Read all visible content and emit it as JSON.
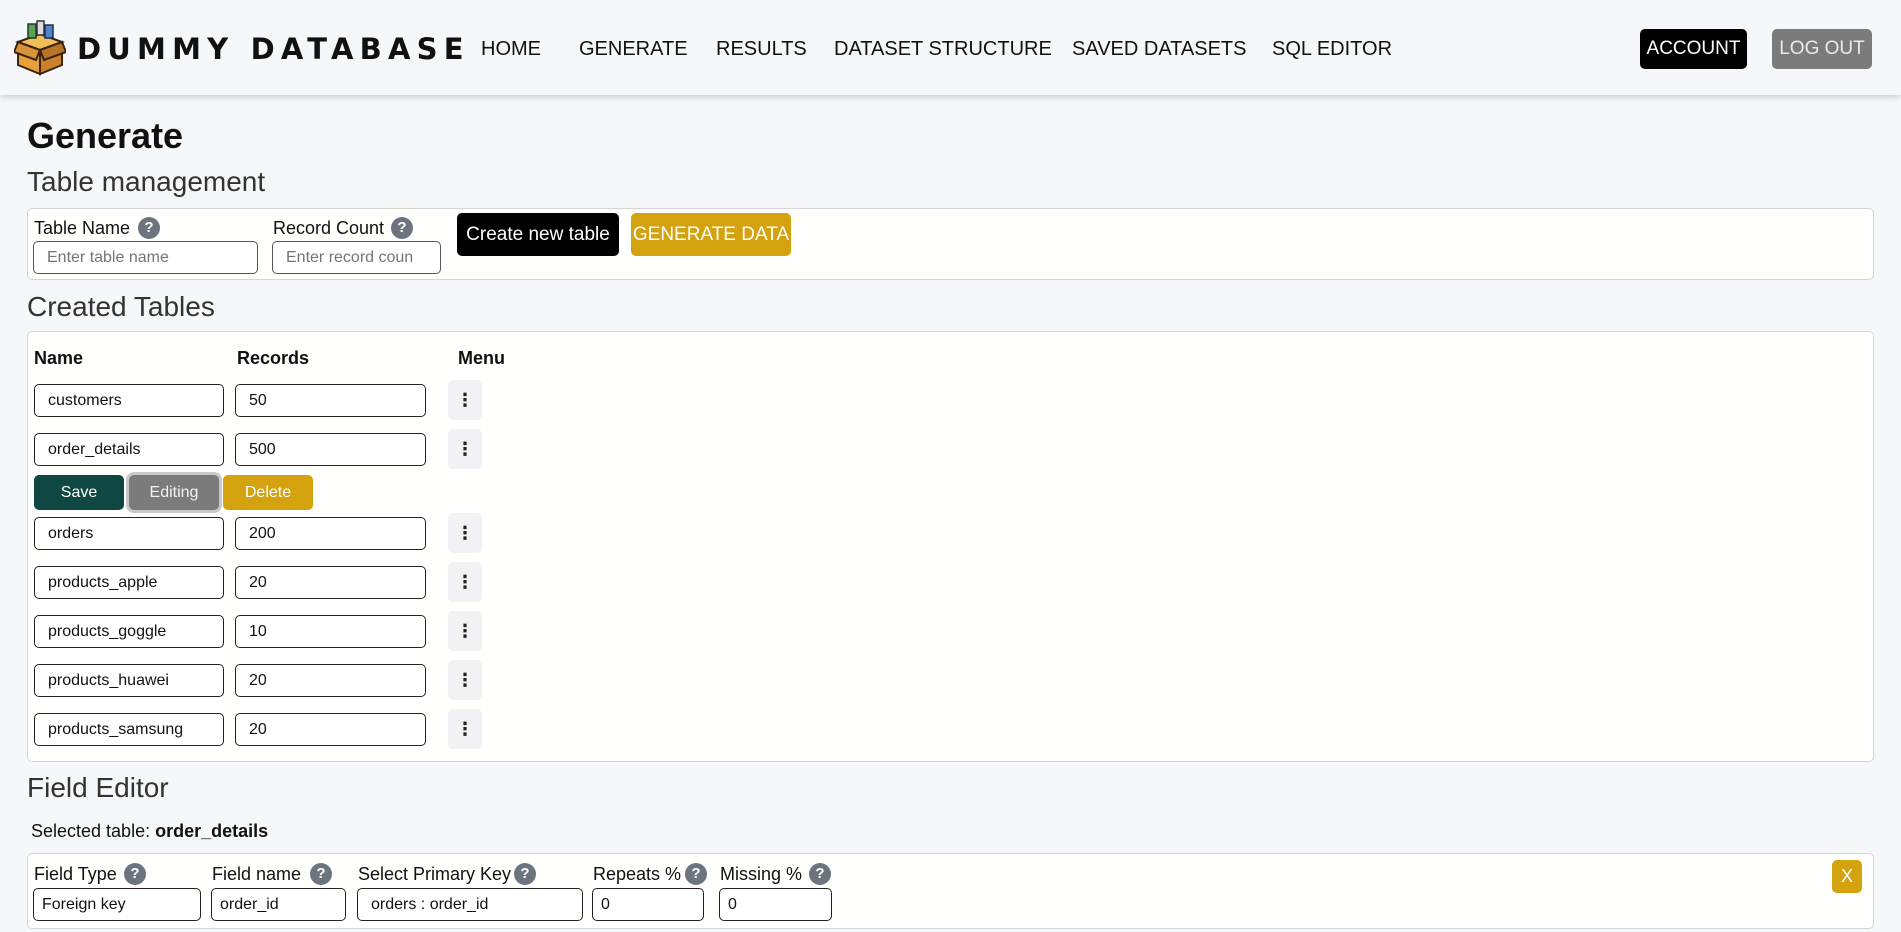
{
  "brand": "DUMMY DATABASE",
  "nav": [
    "HOME",
    "GENERATE",
    "RESULTS",
    "DATASET STRUCTURE",
    "SAVED DATASETS",
    "SQL EDITOR"
  ],
  "account_label": "ACCOUNT",
  "logout_label": "LOG OUT",
  "page_title": "Generate",
  "table_mgmt": {
    "heading": "Table management",
    "table_name_label": "Table Name",
    "table_name_placeholder": "Enter table name",
    "record_count_label": "Record Count",
    "record_count_placeholder": "Enter record coun",
    "create_label": "Create new table",
    "generate_label": "GENERATE DATA",
    "help_glyph": "?"
  },
  "created_tables": {
    "heading": "Created Tables",
    "col_name": "Name",
    "col_records": "Records",
    "col_menu": "Menu",
    "menu_glyph": "⋮",
    "rows": [
      {
        "name": "customers",
        "records": "50"
      },
      {
        "name": "order_details",
        "records": "500"
      },
      {
        "name": "orders",
        "records": "200"
      },
      {
        "name": "products_apple",
        "records": "20"
      },
      {
        "name": "products_goggle",
        "records": "10"
      },
      {
        "name": "products_huawei",
        "records": "20"
      },
      {
        "name": "products_samsung",
        "records": "20"
      }
    ],
    "actions": {
      "save": "Save",
      "editing": "Editing",
      "delete": "Delete"
    }
  },
  "field_editor": {
    "heading": "Field Editor",
    "selected_prefix": "Selected table:",
    "selected_table": "order_details",
    "field_type_label": "Field Type",
    "field_name_label": "Field name",
    "primary_key_label": "Select Primary Key",
    "repeats_label": "Repeats %",
    "missing_label": "Missing %",
    "field_type_value": "Foreign key",
    "field_name_value": "order_id",
    "primary_key_value": "orders : order_id",
    "repeats_value": "0",
    "missing_value": "0",
    "close_label": "X"
  },
  "colors": {
    "accent_gold": "#d4a20e",
    "save_green": "#0f4743",
    "help_gray": "#6c757d"
  }
}
